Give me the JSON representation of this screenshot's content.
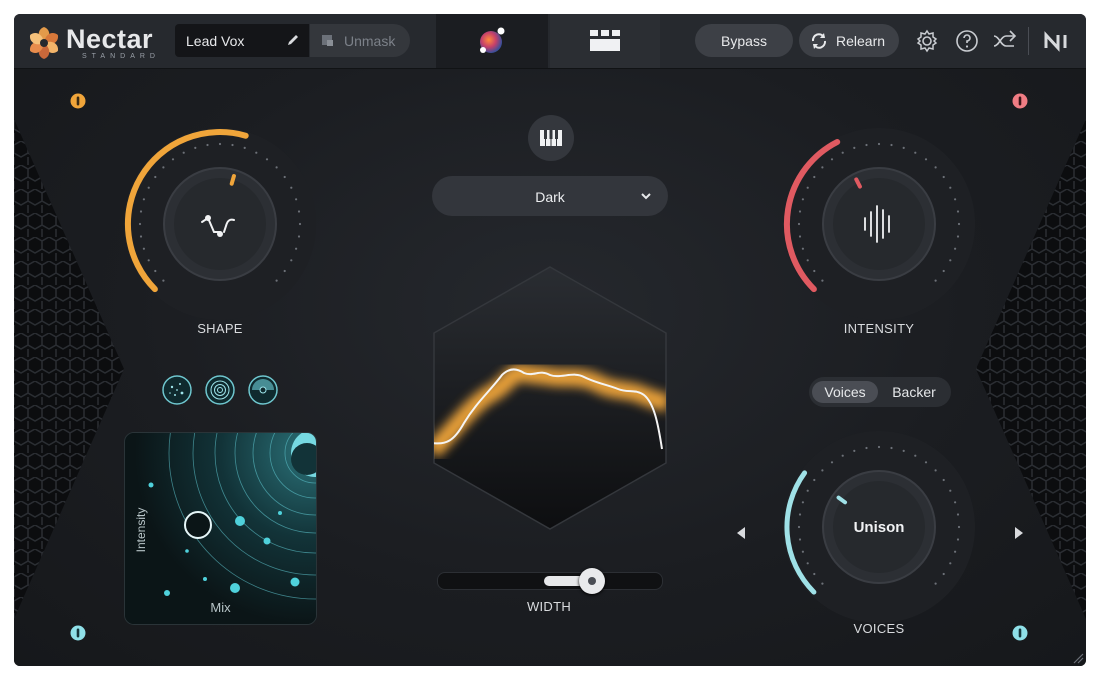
{
  "header": {
    "logo": "Nectar",
    "logo_sub": "STANDARD",
    "preset_name": "Lead Vox",
    "unmask_label": "Unmask",
    "bypass_label": "Bypass",
    "relearn_label": "Relearn"
  },
  "icons": {
    "logo": "nectar-flower-icon",
    "preset_edit": "pencil-icon",
    "unmask": "unmask-icon",
    "tab_visual": "orb-tab-icon",
    "tab_modules": "module-grid-tab-icon",
    "relearn": "relearn-refresh-icon",
    "settings": "gear-icon",
    "help": "help-icon",
    "routing": "routing-icon",
    "ni": "ni-brand-icon",
    "piano": "piano-keys-icon"
  },
  "shape": {
    "label": "SHAPE",
    "level": 0.56
  },
  "intensity": {
    "label": "INTENSITY",
    "level": 0.4
  },
  "tone": {
    "selected": "Dark"
  },
  "width": {
    "label": "WIDTH",
    "level": 0.7
  },
  "xy_pad": {
    "y_label": "Intensity",
    "x_label": "Mix"
  },
  "voices": {
    "toggle_options": [
      "Voices",
      "Backer"
    ],
    "active_option": "Voices",
    "mode": "Unison",
    "label": "VOICES",
    "level": 0.3
  },
  "colors": {
    "orange": "#f0a53a",
    "red": "#e05a61",
    "teal": "#7fd3da",
    "panel": "#1b1d21"
  }
}
